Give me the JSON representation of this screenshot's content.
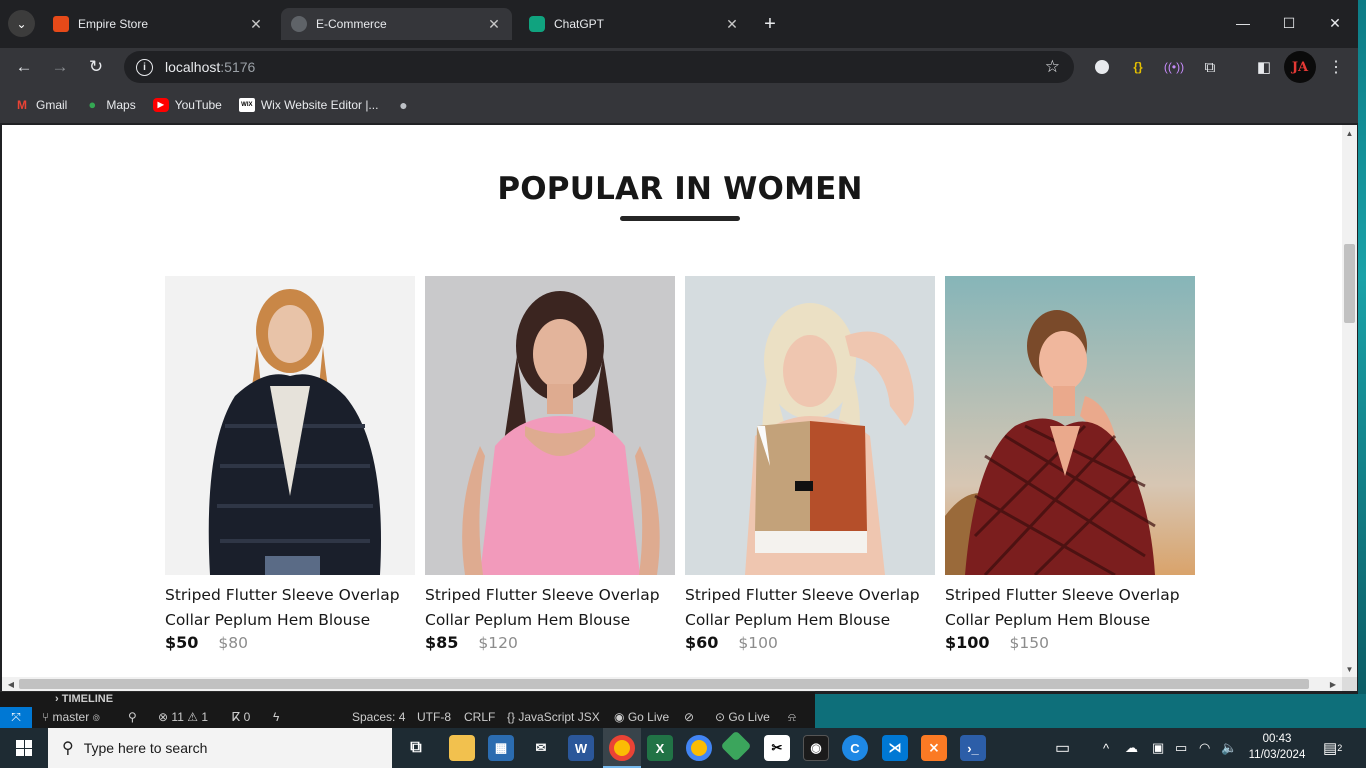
{
  "browser": {
    "tabs": [
      {
        "title": "Empire Store",
        "active": false,
        "favicon": "store-favicon"
      },
      {
        "title": "E-Commerce",
        "active": true,
        "favicon": "globe-favicon"
      },
      {
        "title": "ChatGPT",
        "active": false,
        "favicon": "chatgpt-favicon"
      }
    ],
    "url_host": "localhost",
    "url_port": ":5176",
    "profile_initials": "JA",
    "bookmarks": [
      {
        "label": "Gmail",
        "icon": "gmail-icon"
      },
      {
        "label": "Maps",
        "icon": "maps-icon"
      },
      {
        "label": "YouTube",
        "icon": "youtube-icon"
      },
      {
        "label": "Wix Website Editor |...",
        "icon": "wix-icon"
      }
    ]
  },
  "page": {
    "section_title": "POPULAR IN WOMEN",
    "products": [
      {
        "name": "Striped Flutter Sleeve Overlap Collar Peplum Hem Blouse",
        "new_price": "$50",
        "old_price": "$80",
        "image": "woman in black fur jacket"
      },
      {
        "name": "Striped Flutter Sleeve Overlap Collar Peplum Hem Blouse",
        "new_price": "$85",
        "old_price": "$120",
        "image": "woman in pink top"
      },
      {
        "name": "Striped Flutter Sleeve Overlap Collar Peplum Hem Blouse",
        "new_price": "$60",
        "old_price": "$100",
        "image": "woman in color-block crop top"
      },
      {
        "name": "Striped Flutter Sleeve Overlap Collar Peplum Hem Blouse",
        "new_price": "$100",
        "old_price": "$150",
        "image": "woman in red patterned top"
      }
    ]
  },
  "vscode": {
    "timeline_label": "TIMELINE",
    "branch": "master",
    "errors": "11",
    "warnings": "1",
    "ports": "0",
    "spaces": "Spaces: 4",
    "encoding": "UTF-8",
    "eol": "CRLF",
    "language": "JavaScript JSX",
    "go_live_1": "Go Live",
    "go_live_2": "Go Live"
  },
  "taskbar": {
    "search_placeholder": "Type here to search",
    "time": "00:43",
    "date": "11/03/2024",
    "notification_count": "2"
  }
}
